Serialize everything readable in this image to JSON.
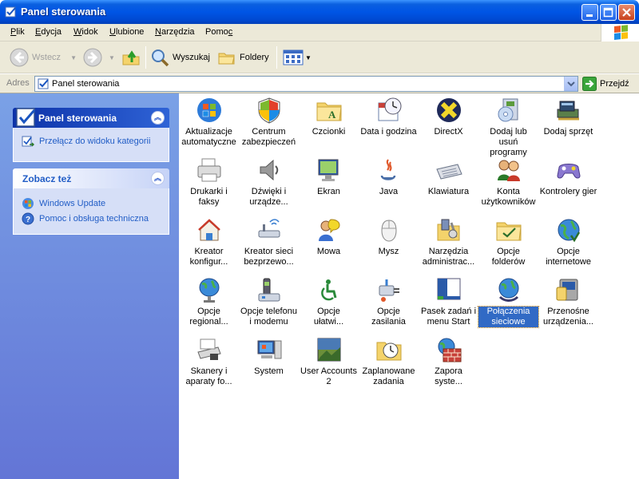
{
  "window": {
    "title": "Panel sterowania"
  },
  "menu": {
    "items": [
      {
        "before": "",
        "ul": "P",
        "after": "lik"
      },
      {
        "before": "",
        "ul": "E",
        "after": "dycja"
      },
      {
        "before": "",
        "ul": "W",
        "after": "idok"
      },
      {
        "before": "",
        "ul": "U",
        "after": "lubione"
      },
      {
        "before": "",
        "ul": "N",
        "after": "arzędzia"
      },
      {
        "before": "Pomo",
        "ul": "c",
        "after": ""
      }
    ]
  },
  "toolbar": {
    "back_label": "Wstecz",
    "search_label": "Wyszukaj",
    "folders_label": "Foldery"
  },
  "address": {
    "label": "Adres",
    "value": "Panel sterowania",
    "go_label": "Przejdź"
  },
  "sidebar": {
    "panel_title": "Panel sterowania",
    "switch_link": "Przełącz do widoku kategorii",
    "see_also_title": "Zobacz też",
    "see_also_links": [
      "Windows Update",
      "Pomoc i obsługa techniczna"
    ]
  },
  "items": [
    {
      "line1": "Aktualizacje",
      "line2": "automatyczne",
      "icon": "windows-flag-icon"
    },
    {
      "line1": "Centrum",
      "line2": "zabezpieczeń",
      "icon": "shield-icon"
    },
    {
      "line1": "Czcionki",
      "line2": "",
      "icon": "fonts-folder-icon"
    },
    {
      "line1": "Data i godzina",
      "line2": "",
      "icon": "clock-calendar-icon"
    },
    {
      "line1": "DirectX",
      "line2": "",
      "icon": "directx-icon"
    },
    {
      "line1": "Dodaj lub usuń",
      "line2": "programy",
      "icon": "add-remove-programs-icon"
    },
    {
      "line1": "Dodaj sprzęt",
      "line2": "",
      "icon": "add-hardware-icon"
    },
    {
      "line1": "Drukarki i",
      "line2": "faksy",
      "icon": "printer-icon"
    },
    {
      "line1": "Dźwięki i",
      "line2": "urządze...",
      "icon": "speaker-icon"
    },
    {
      "line1": "Ekran",
      "line2": "",
      "icon": "display-icon"
    },
    {
      "line1": "Java",
      "line2": "",
      "icon": "java-icon"
    },
    {
      "line1": "Klawiatura",
      "line2": "",
      "icon": "keyboard-icon"
    },
    {
      "line1": "Konta",
      "line2": "użytkowników",
      "icon": "users-icon"
    },
    {
      "line1": "Kontrolery gier",
      "line2": "",
      "icon": "gamepad-icon"
    },
    {
      "line1": "Kreator",
      "line2": "konfigur...",
      "icon": "network-setup-icon"
    },
    {
      "line1": "Kreator sieci",
      "line2": "bezprzewo...",
      "icon": "wireless-icon"
    },
    {
      "line1": "Mowa",
      "line2": "",
      "icon": "speech-icon"
    },
    {
      "line1": "Mysz",
      "line2": "",
      "icon": "mouse-icon"
    },
    {
      "line1": "Narzędzia",
      "line2": "administrac...",
      "icon": "admin-tools-icon"
    },
    {
      "line1": "Opcje",
      "line2": "folderów",
      "icon": "folder-options-icon"
    },
    {
      "line1": "Opcje",
      "line2": "internetowe",
      "icon": "internet-options-icon"
    },
    {
      "line1": "Opcje",
      "line2": "regional...",
      "icon": "globe-icon"
    },
    {
      "line1": "Opcje telefonu",
      "line2": "i modemu",
      "icon": "phone-icon"
    },
    {
      "line1": "Opcje",
      "line2": "ułatwi...",
      "icon": "accessibility-icon"
    },
    {
      "line1": "Opcje zasilania",
      "line2": "",
      "icon": "power-icon"
    },
    {
      "line1": "Pasek zadań i",
      "line2": "menu Start",
      "icon": "taskbar-icon"
    },
    {
      "line1": "Połączenia",
      "line2": "sieciowe",
      "icon": "network-connections-icon",
      "selected": true
    },
    {
      "line1": "Przenośne",
      "line2": "urządzenia...",
      "icon": "portable-devices-icon"
    },
    {
      "line1": "Skanery i",
      "line2": "aparaty fo...",
      "icon": "scanner-icon"
    },
    {
      "line1": "System",
      "line2": "",
      "icon": "computer-icon"
    },
    {
      "line1": "User Accounts",
      "line2": "2",
      "icon": "user-accounts-icon"
    },
    {
      "line1": "Zaplanowane",
      "line2": "zadania",
      "icon": "scheduled-tasks-icon"
    },
    {
      "line1": "Zapora",
      "line2": "syste...",
      "icon": "firewall-icon"
    }
  ]
}
